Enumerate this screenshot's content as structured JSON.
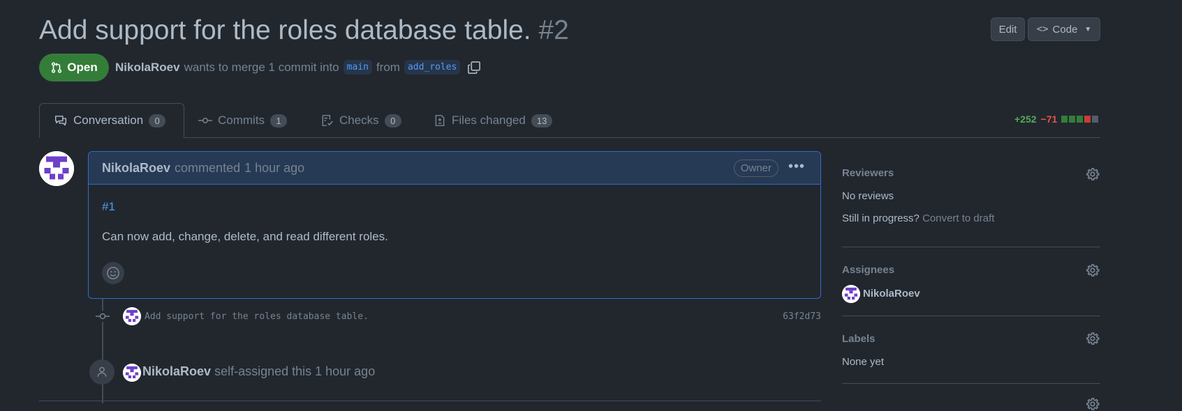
{
  "header": {
    "title": "Add support for the roles database table.",
    "number": "#2",
    "edit_label": "Edit",
    "code_label": "Code"
  },
  "state": {
    "label": "Open",
    "color": "#347d39"
  },
  "meta": {
    "author": "NikolaRoev",
    "text": "wants to merge 1 commit into",
    "base_branch": "main",
    "from_text": "from",
    "head_branch": "add_roles"
  },
  "tabs": [
    {
      "label": "Conversation",
      "count": "0"
    },
    {
      "label": "Commits",
      "count": "1"
    },
    {
      "label": "Checks",
      "count": "0"
    },
    {
      "label": "Files changed",
      "count": "13"
    }
  ],
  "diffstat": {
    "additions": "+252",
    "deletions": "−71",
    "blocks": [
      "#347d39",
      "#347d39",
      "#347d39",
      "#c93c37",
      "#545d68"
    ]
  },
  "comment": {
    "author": "NikolaRoev",
    "action": "commented",
    "time": "1 hour ago",
    "badge": "Owner",
    "issue_link": "#1",
    "body": "Can now add, change, delete, and read different roles."
  },
  "commit": {
    "message": "Add support for the roles database table.",
    "sha": "63f2d73"
  },
  "assignment": {
    "author": "NikolaRoev",
    "text": "self-assigned this 1 hour ago"
  },
  "sidebar": {
    "reviewers_heading": "Reviewers",
    "reviewers_value": "No reviews",
    "in_progress_text": "Still in progress?",
    "convert_draft": "Convert to draft",
    "assignees_heading": "Assignees",
    "assignee": "NikolaRoev",
    "labels_heading": "Labels",
    "labels_value": "None yet"
  },
  "colors": {
    "background": "#22272e",
    "accent_blue": "#539bf5",
    "open_green": "#347d39",
    "avatar_purple": "#6e40c9"
  }
}
